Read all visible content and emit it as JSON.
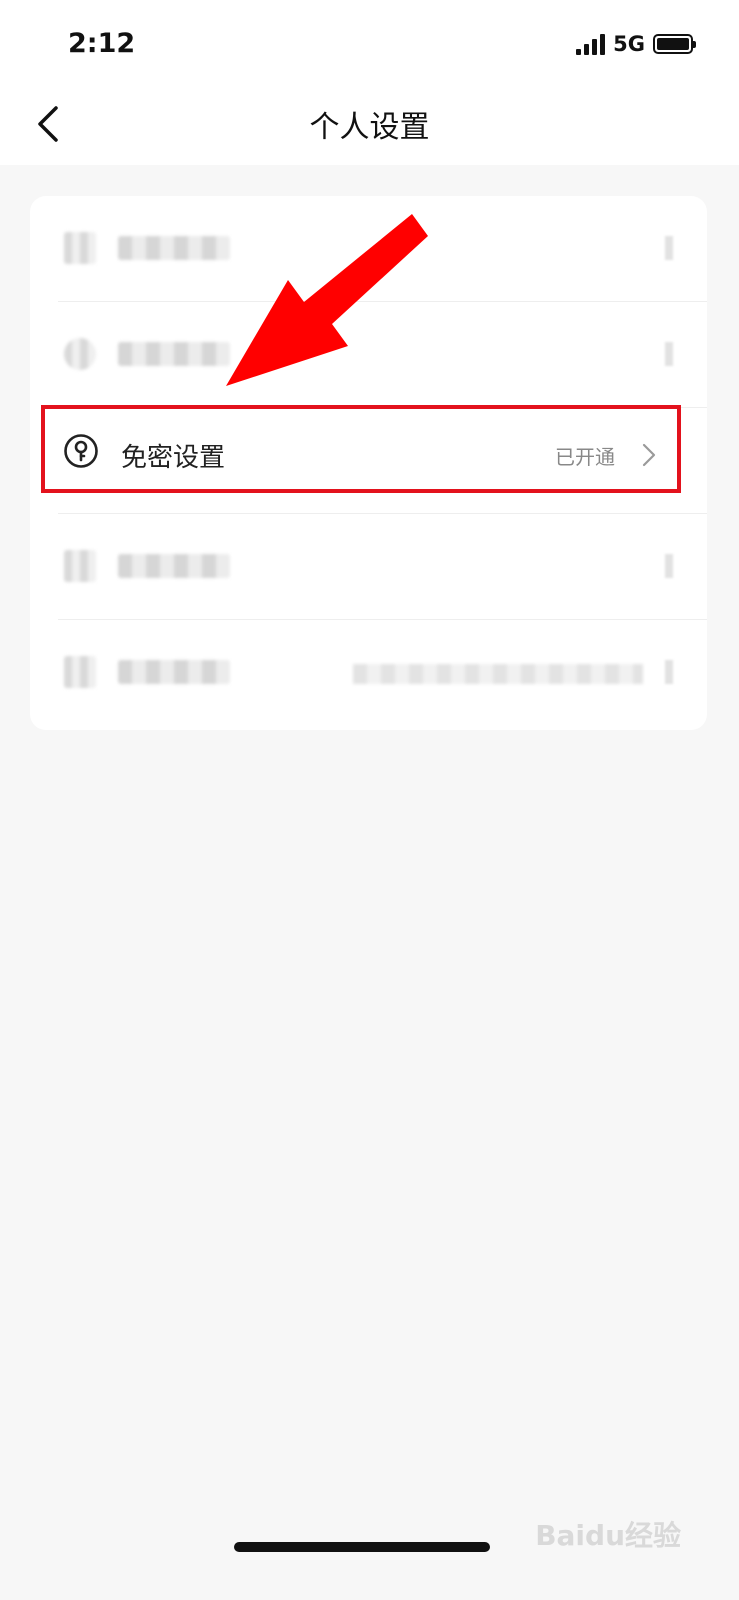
{
  "status_bar": {
    "time": "2:12",
    "network": "5G"
  },
  "nav": {
    "title": "个人设置"
  },
  "settings_item": {
    "label": "免密设置",
    "status": "已开通"
  },
  "watermark": {
    "text": "Baidu经验"
  },
  "colors": {
    "highlight_box": "#e3121d",
    "arrow": "#ff0000",
    "page_background": "#f7f7f7"
  }
}
